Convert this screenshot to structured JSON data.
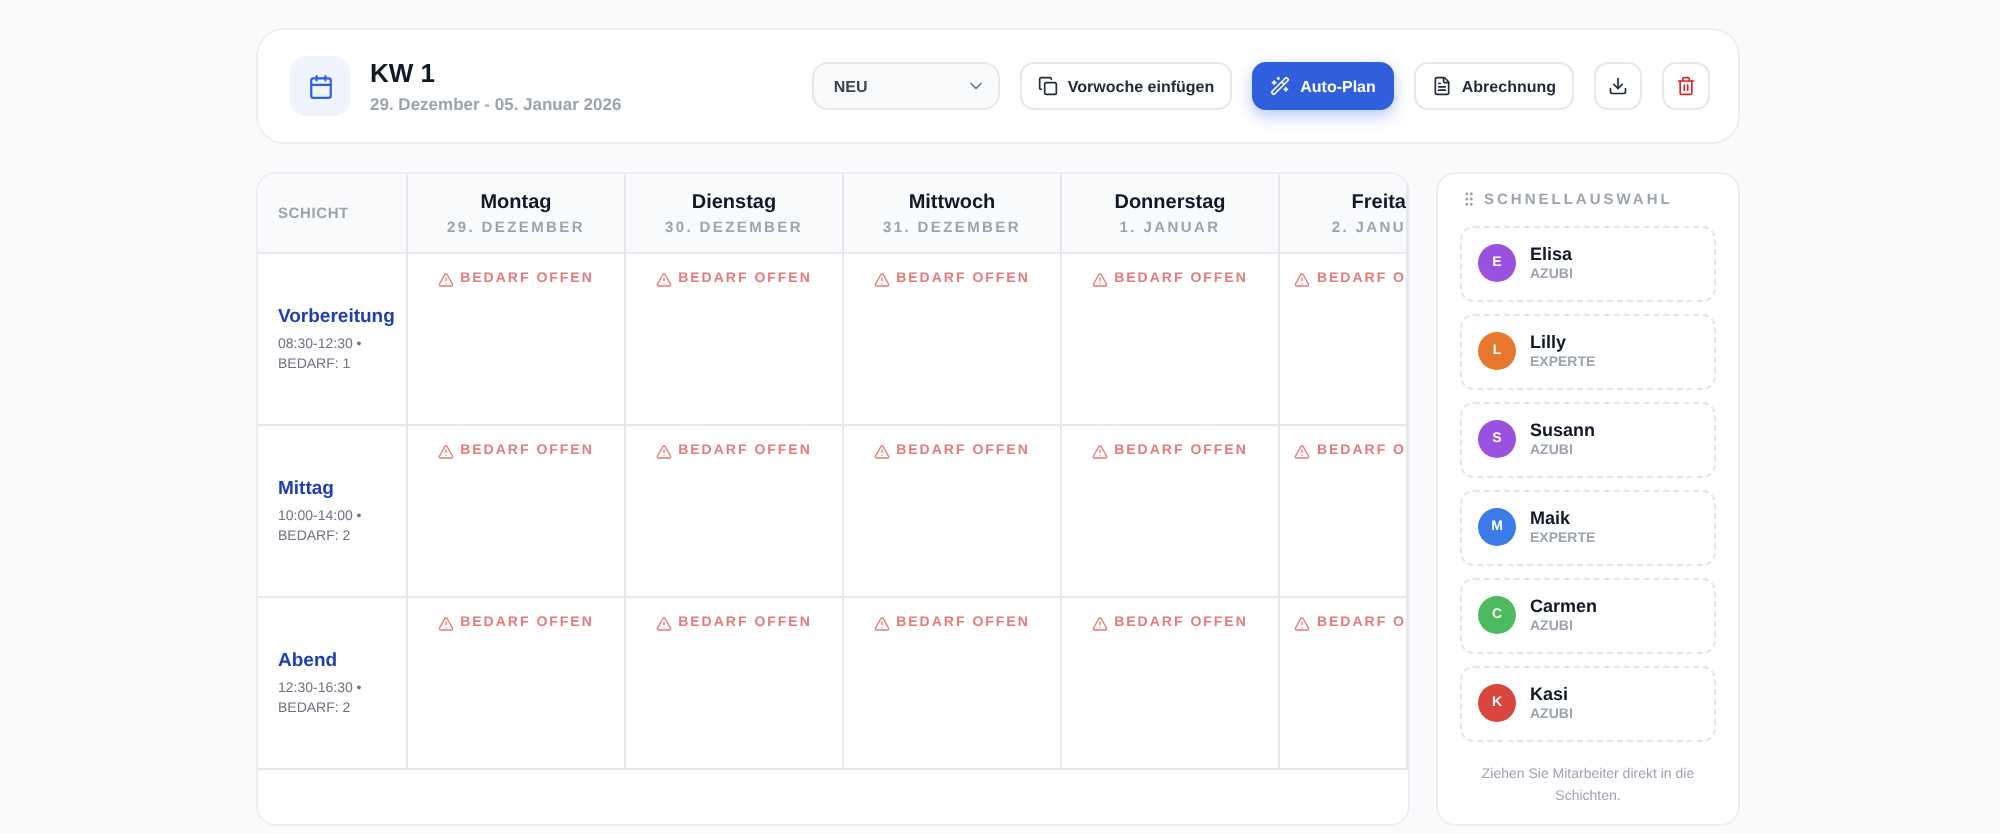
{
  "header": {
    "title": "KW 1",
    "subtitle": "29. Dezember - 05. Januar 2026",
    "select": {
      "value": "NEU"
    },
    "buttons": [
      {
        "kind": "outline",
        "label": "Vorwoche einfügen"
      },
      {
        "kind": "primary",
        "label": "Auto-Plan"
      },
      {
        "kind": "outline",
        "label": "Abrechnung"
      },
      {
        "kind": "icon"
      },
      {
        "kind": "danger"
      }
    ]
  },
  "table": {
    "corner": "SCHICHT",
    "days": [
      {
        "kind": "full",
        "name": "Montag",
        "date": "29. DEZEMBER"
      },
      {
        "kind": "full",
        "name": "Dienstag",
        "date": "30. DEZEMBER"
      },
      {
        "kind": "full",
        "name": "Mittwoch",
        "date": "31. DEZEMBER"
      },
      {
        "kind": "full",
        "name": "Donnerstag",
        "date": "1. JANUAR"
      },
      {
        "kind": "cut",
        "name": "Freita",
        "date": "2. JANU"
      }
    ],
    "shifts": [
      {
        "name": "Vorbereitung",
        "time": "08:30-12:30 •",
        "need": "BEDARF: 1",
        "cells": [
          "BEDARF OFFEN",
          "BEDARF OFFEN",
          "BEDARF OFFEN",
          "BEDARF OFFEN",
          "BEDARF O"
        ]
      },
      {
        "name": "Mittag",
        "time": "10:00-14:00 •",
        "need": "BEDARF: 2",
        "cells": [
          "BEDARF OFFEN",
          "BEDARF OFFEN",
          "BEDARF OFFEN",
          "BEDARF OFFEN",
          "BEDARF O"
        ]
      },
      {
        "name": "Abend",
        "time": "12:30-16:30 •",
        "need": "BEDARF: 2",
        "cells": [
          "BEDARF OFFEN",
          "BEDARF OFFEN",
          "BEDARF OFFEN",
          "BEDARF OFFEN",
          "BEDARF O"
        ]
      }
    ]
  },
  "sidebar": {
    "title": "SCHNELLAUSWAHL",
    "employees": [
      {
        "initial": "E",
        "name": "Elisa",
        "role": "AZUBI",
        "color": "#9b51e0"
      },
      {
        "initial": "L",
        "name": "Lilly",
        "role": "EXPERTE",
        "color": "#e8782e"
      },
      {
        "initial": "S",
        "name": "Susann",
        "role": "AZUBI",
        "color": "#9b51e0"
      },
      {
        "initial": "M",
        "name": "Maik",
        "role": "EXPERTE",
        "color": "#3b7be8"
      },
      {
        "initial": "C",
        "name": "Carmen",
        "role": "AZUBI",
        "color": "#4cbb5f"
      },
      {
        "initial": "K",
        "name": "Kasi",
        "role": "AZUBI",
        "color": "#d9463e"
      }
    ],
    "hint": "Ziehen Sie Mitarbeiter direkt in die Schichten."
  }
}
